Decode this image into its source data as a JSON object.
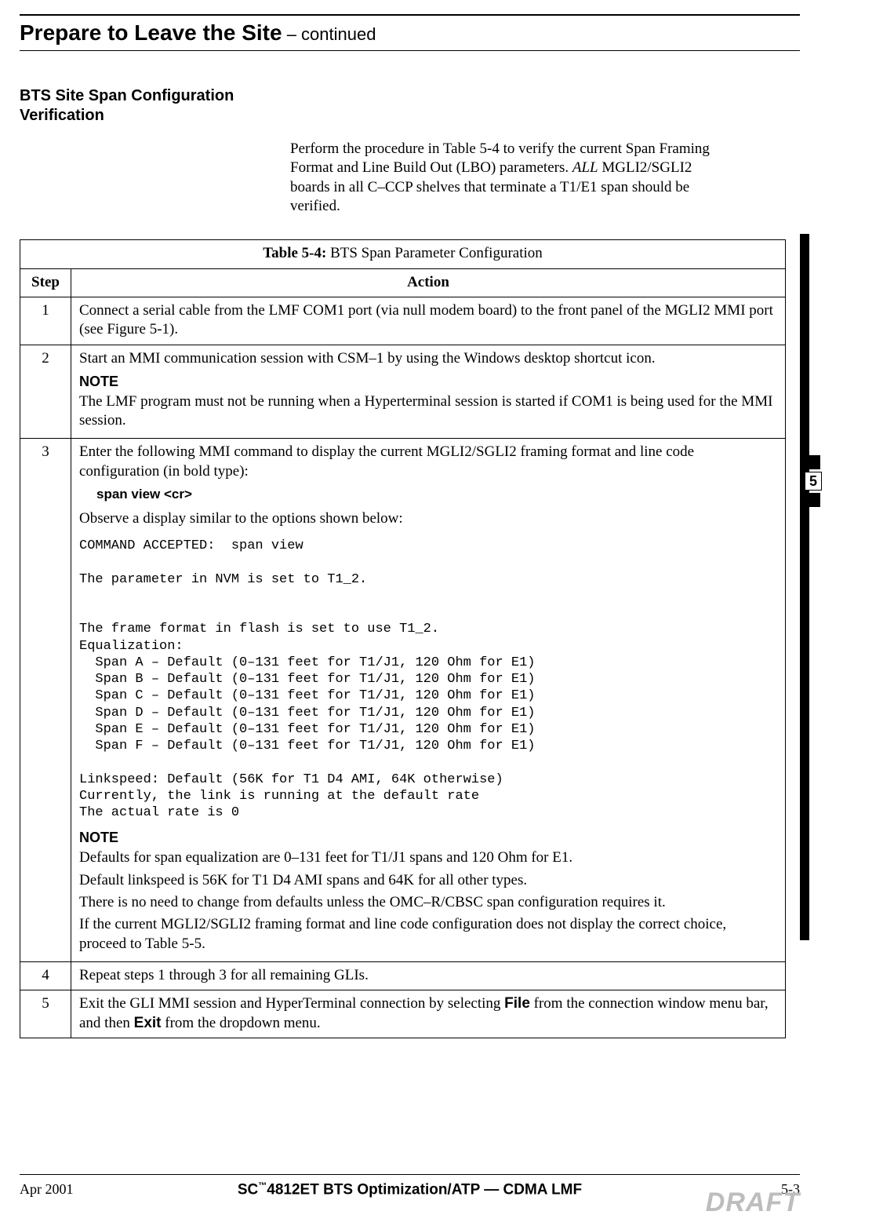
{
  "header": {
    "title_main": "Prepare to Leave the Site",
    "title_cont": " – continued"
  },
  "section": {
    "heading": "BTS Site Span Configuration Verification",
    "intro_pre": "Perform the procedure in Table 5-4 to verify the current Span Framing Format and Line Build Out (LBO) parameters. ",
    "intro_ital": "ALL",
    "intro_post": " MGLI2/SGLI2 boards in all C–CCP shelves that terminate a T1/E1 span should be verified."
  },
  "table": {
    "caption_bold": "Table 5-4:",
    "caption_rest": " BTS Span Parameter Configuration",
    "head_step": "Step",
    "head_action": "Action",
    "steps": {
      "s1": {
        "num": "1",
        "text": "Connect a serial cable from the LMF COM1 port (via null modem board) to the front panel of the MGLI2 MMI port (see Figure 5-1)."
      },
      "s2": {
        "num": "2",
        "line1": "Start an MMI communication session with CSM–1 by using the Windows desktop shortcut icon.",
        "note_label": "NOTE",
        "note_text": "The LMF program must not be running when a Hyperterminal session is started if COM1 is being used for the MMI session."
      },
      "s3": {
        "num": "3",
        "line1": "Enter the following MMI command to display the current MGLI2/SGLI2 framing format and line code configuration (in bold type):",
        "cmd": "span  view  <cr>",
        "line2": "Observe a display similar to the options shown below:",
        "mono": "COMMAND ACCEPTED:  span view\n\nThe parameter in NVM is set to T1_2.\n\n\nThe frame format in flash is set to use T1_2.\nEqualization:\n  Span A – Default (0–131 feet for T1/J1, 120 Ohm for E1)\n  Span B – Default (0–131 feet for T1/J1, 120 Ohm for E1)\n  Span C – Default (0–131 feet for T1/J1, 120 Ohm for E1)\n  Span D – Default (0–131 feet for T1/J1, 120 Ohm for E1)\n  Span E – Default (0–131 feet for T1/J1, 120 Ohm for E1)\n  Span F – Default (0–131 feet for T1/J1, 120 Ohm for E1)\n\nLinkspeed: Default (56K for T1 D4 AMI, 64K otherwise)\nCurrently, the link is running at the default rate\nThe actual rate is 0",
        "note_label": "NOTE",
        "note_p1": "Defaults for span equalization are 0–131 feet for T1/J1 spans and 120 Ohm for E1.",
        "note_p2": "Default linkspeed is 56K for T1 D4 AMI spans and 64K for all other types.",
        "note_p3": "There is no need to change from defaults unless the OMC–R/CBSC span configuration requires it.",
        "note_p4": "If the current MGLI2/SGLI2 framing format and line code configuration does not display the correct choice, proceed to Table 5-5."
      },
      "s4": {
        "num": "4",
        "text": "Repeat steps 1 through 3 for all remaining GLIs."
      },
      "s5": {
        "num": "5",
        "pre": "Exit the GLI MMI session and HyperTerminal connection by selecting ",
        "file_label": "File",
        "mid": " from the connection window menu bar, and then ",
        "exit_label": "Exit",
        "post": " from the dropdown menu."
      }
    }
  },
  "tab": {
    "num": "5"
  },
  "footer": {
    "left": "Apr 2001",
    "center_pre": "SC",
    "center_tm": "™",
    "center_post": "4812ET BTS Optimization/ATP — CDMA LMF",
    "right": "5-3",
    "draft": "DRAFT"
  }
}
